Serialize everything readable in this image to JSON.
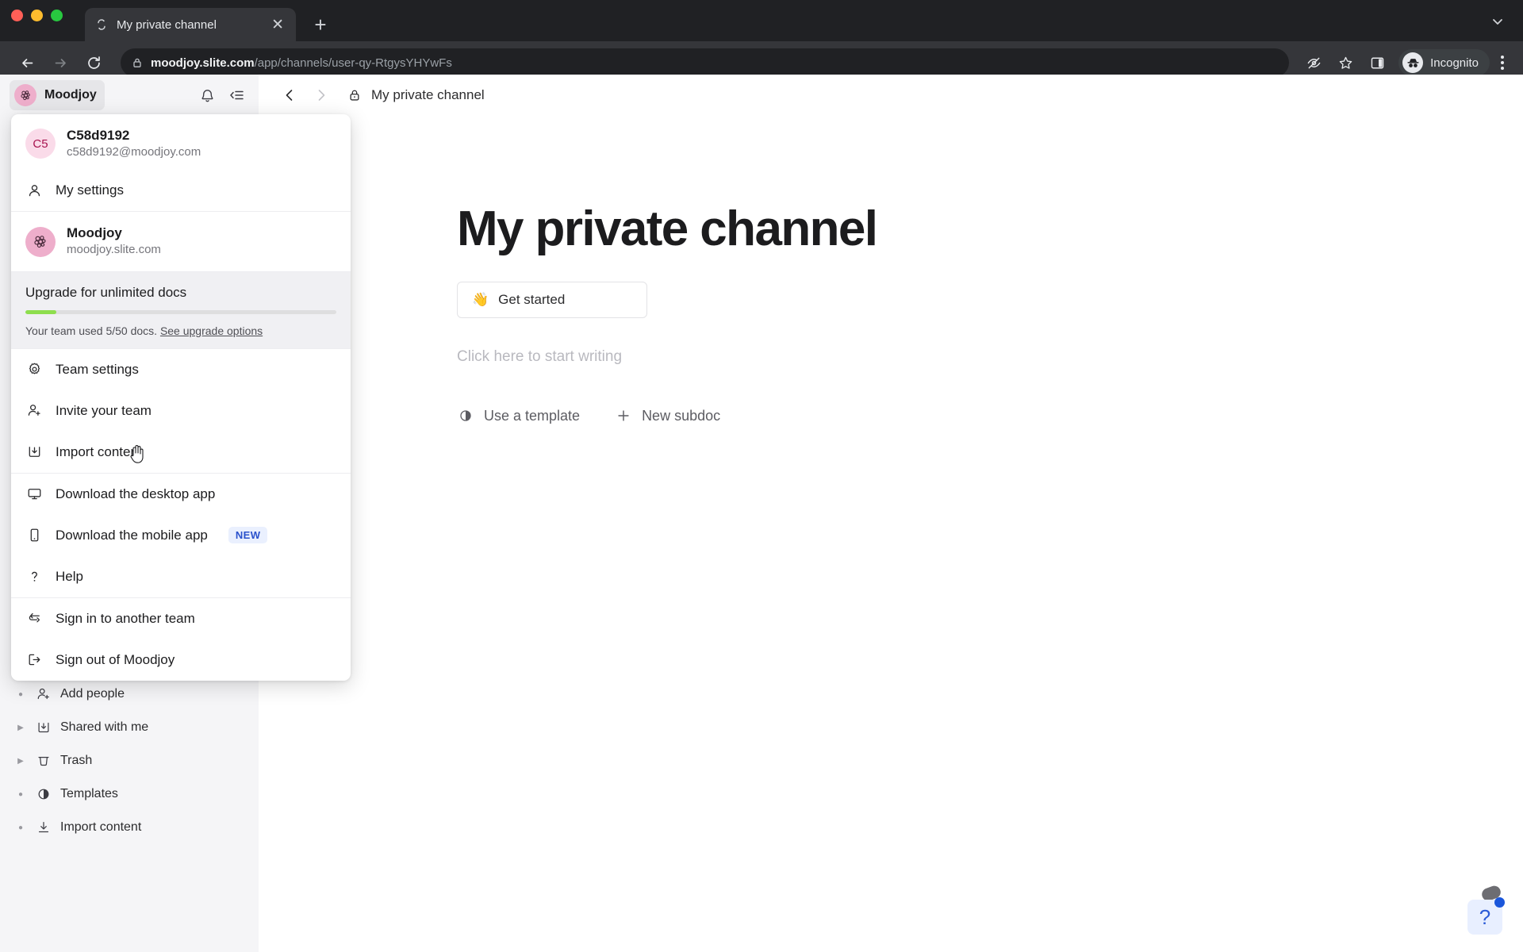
{
  "browser": {
    "tab": {
      "title": "My private channel",
      "favicon_icon": "slite-favicon",
      "close_icon": "close-icon"
    },
    "new_tab_icon": "plus-icon",
    "tabstrip_chevron_icon": "chevron-down-icon",
    "back_icon": "arrow-left-icon",
    "forward_icon": "arrow-right-icon",
    "reload_icon": "reload-icon",
    "lock_icon": "lock-icon",
    "url": {
      "host": "moodjoy.slite.com",
      "path": "/app/channels/user-qy-RtgysYHYwFs"
    },
    "actions": {
      "tracking_icon": "eye-off-icon",
      "bookmark_icon": "star-icon",
      "sidepanel_icon": "side-panel-icon",
      "profile_icon": "incognito-icon",
      "profile_label": "Incognito",
      "menu_icon": "three-dot-menu-icon"
    }
  },
  "sidebar": {
    "team": {
      "name": "Moodjoy",
      "logo_icon": "moodjoy-logo-icon"
    },
    "header_actions": [
      {
        "name": "notifications",
        "icon": "bell-icon"
      },
      {
        "name": "collapse-sidebar",
        "icon": "collapse-sidebar-icon"
      }
    ],
    "items": [
      {
        "label": "Add people",
        "icon": "add-person-icon",
        "marker": "dot"
      },
      {
        "label": "Shared with me",
        "icon": "inbox-download-icon",
        "marker": "caret"
      },
      {
        "label": "Trash",
        "icon": "trash-icon",
        "marker": "caret"
      },
      {
        "label": "Templates",
        "icon": "template-icon",
        "marker": "dot"
      },
      {
        "label": "Import content",
        "icon": "download-icon",
        "marker": "dot"
      }
    ]
  },
  "menu": {
    "account": {
      "avatar_initials": "C5",
      "name": "C58d9192",
      "email": "c58d9192@moodjoy.com"
    },
    "my_settings": {
      "label": "My settings",
      "icon": "person-icon"
    },
    "team": {
      "name": "Moodjoy",
      "domain": "moodjoy.slite.com",
      "logo_icon": "moodjoy-logo-icon"
    },
    "upgrade": {
      "title": "Upgrade for unlimited docs",
      "progress_percent": 10,
      "usage_text": "Your team used 5/50 docs.",
      "link_label": "See upgrade options",
      "bar_color": "#8ede4e"
    },
    "groups": [
      [
        {
          "label": "Team settings",
          "icon": "gear-icon"
        },
        {
          "label": "Invite your team",
          "icon": "add-person-icon"
        },
        {
          "label": "Import content",
          "icon": "inbox-download-icon"
        }
      ],
      [
        {
          "label": "Download the desktop app",
          "icon": "desktop-icon"
        },
        {
          "label": "Download the mobile app",
          "icon": "mobile-icon",
          "badge": "NEW"
        },
        {
          "label": "Help",
          "icon": "question-mark-icon"
        }
      ],
      [
        {
          "label": "Sign in to another team",
          "icon": "switch-arrows-icon"
        },
        {
          "label": "Sign out of Moodjoy",
          "icon": "sign-out-icon"
        }
      ]
    ]
  },
  "doc": {
    "nav": {
      "back_icon": "chevron-left-icon",
      "forward_icon": "chevron-right-icon"
    },
    "breadcrumb": {
      "icon": "lock-icon",
      "label": "My private channel"
    },
    "title": "My private channel",
    "get_started": {
      "emoji": "👋",
      "label": "Get started"
    },
    "editor_placeholder": "Click here to start writing",
    "actions": [
      {
        "label": "Use a template",
        "icon": "template-icon"
      },
      {
        "label": "New subdoc",
        "icon": "plus-icon"
      }
    ]
  },
  "help_widget": {
    "icon": "question-mark-icon",
    "has_notification": true
  }
}
